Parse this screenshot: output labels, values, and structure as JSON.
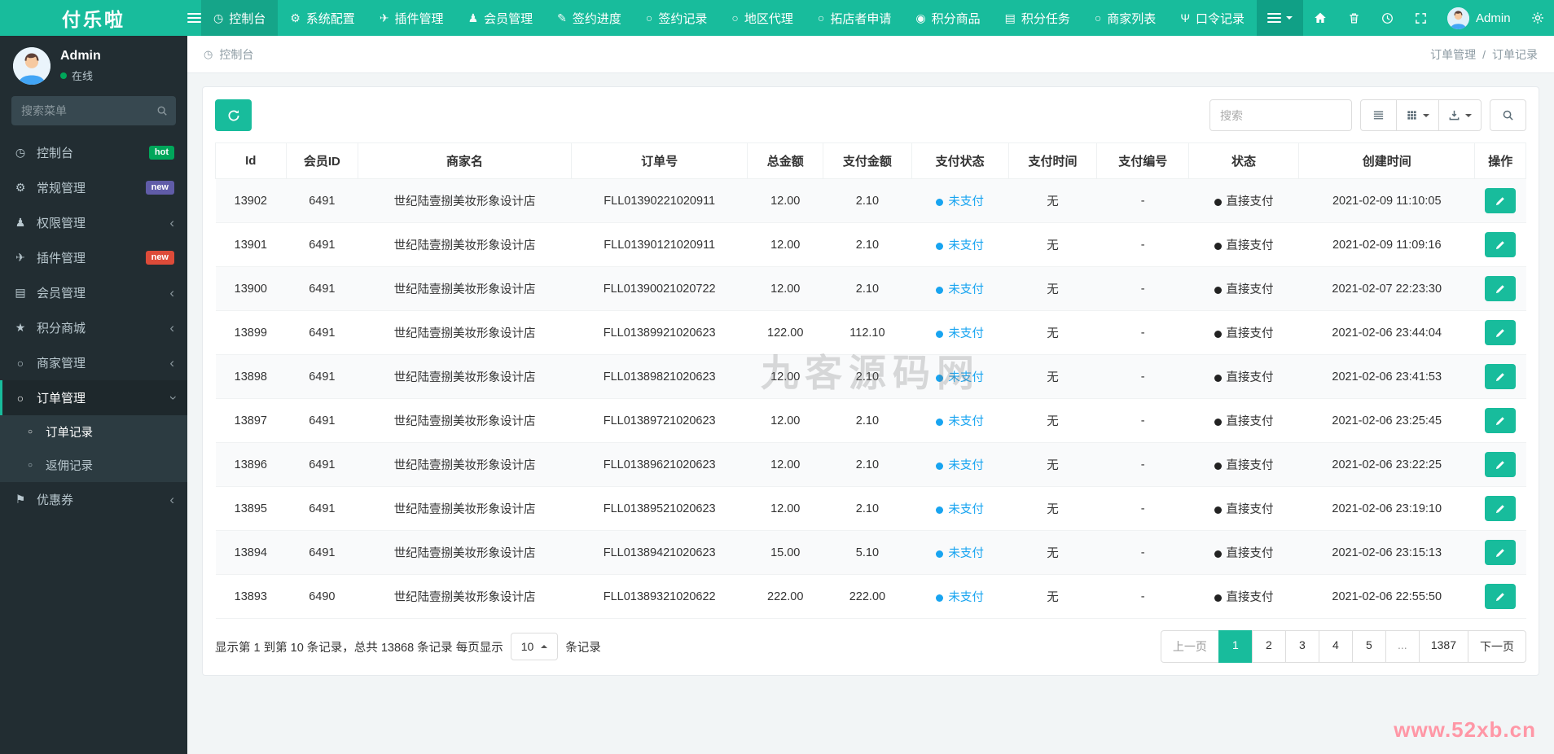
{
  "brand": "付乐啦",
  "colors": {
    "accent": "#18bc9c",
    "navbar_active": "#15a589",
    "sidebar_bg": "#222d32",
    "unpaid_blue": "#18a4f0",
    "status_dark": "#222222",
    "badge_hot": "#00a65a",
    "badge_new_purple": "#605ca8",
    "badge_new_red": "#dd4b39"
  },
  "topnav": {
    "items": [
      {
        "key": "dashboard",
        "label": "控制台",
        "glyph": "◷",
        "active": true
      },
      {
        "key": "system-config",
        "label": "系统配置",
        "glyph": "⚙"
      },
      {
        "key": "plugin-manage",
        "label": "插件管理",
        "glyph": "✈"
      },
      {
        "key": "member-manage",
        "label": "会员管理",
        "glyph": "♟"
      },
      {
        "key": "sign-progress",
        "label": "签约进度",
        "glyph": "✎"
      },
      {
        "key": "sign-records",
        "label": "签约记录",
        "glyph": "○"
      },
      {
        "key": "region-agent",
        "label": "地区代理",
        "glyph": "○"
      },
      {
        "key": "store-apply",
        "label": "拓店者申请",
        "glyph": "○"
      },
      {
        "key": "points-goods",
        "label": "积分商品",
        "glyph": "◉"
      },
      {
        "key": "points-task",
        "label": "积分任务",
        "glyph": "▤"
      },
      {
        "key": "merchant-list",
        "label": "商家列表",
        "glyph": "○"
      },
      {
        "key": "token-records",
        "label": "口令记录",
        "glyph": "Ψ"
      }
    ],
    "user_name": "Admin"
  },
  "sidebar": {
    "user": {
      "name": "Admin",
      "status": "在线"
    },
    "search_placeholder": "搜索菜单",
    "items": [
      {
        "key": "dashboard",
        "label": "控制台",
        "glyph": "◷",
        "icon": "dashboard-icon",
        "badge": {
          "text": "hot",
          "color": "#00a65a"
        }
      },
      {
        "key": "general",
        "label": "常规管理",
        "glyph": "⚙",
        "icon": "gears-icon",
        "badge": {
          "text": "new",
          "color": "#605ca8"
        }
      },
      {
        "key": "auth",
        "label": "权限管理",
        "glyph": "♟",
        "icon": "users-icon",
        "chevron": "left"
      },
      {
        "key": "addon",
        "label": "插件管理",
        "glyph": "✈",
        "icon": "plugin-icon",
        "badge": {
          "text": "new",
          "color": "#dd4b39"
        }
      },
      {
        "key": "member",
        "label": "会员管理",
        "glyph": "▤",
        "icon": "list-icon",
        "chevron": "left"
      },
      {
        "key": "points-mall",
        "label": "积分商城",
        "glyph": "★",
        "icon": "star-icon",
        "chevron": "left"
      },
      {
        "key": "merchant",
        "label": "商家管理",
        "glyph": "○",
        "icon": "circle-icon",
        "chevron": "left"
      },
      {
        "key": "order",
        "label": "订单管理",
        "glyph": "○",
        "icon": "circle-icon",
        "chevron": "down",
        "active": true,
        "children": [
          {
            "key": "order-records",
            "label": "订单记录",
            "active": true
          },
          {
            "key": "rebate-records",
            "label": "返佣记录"
          }
        ]
      },
      {
        "key": "coupon",
        "label": "优惠券",
        "glyph": "⚑",
        "icon": "bookmark-icon",
        "chevron": "left"
      }
    ]
  },
  "breadcrumb": {
    "left": "控制台",
    "parent": "订单管理",
    "separator": "/",
    "current": "订单记录"
  },
  "toolbar": {
    "search_placeholder": "搜索"
  },
  "table": {
    "headers": [
      "Id",
      "会员ID",
      "商家名",
      "订单号",
      "总金额",
      "支付金额",
      "支付状态",
      "支付时间",
      "支付编号",
      "状态",
      "创建时间",
      "操作"
    ],
    "rows": [
      {
        "id": "13902",
        "member_id": "6491",
        "merchant": "世纪陆壹捌美妆形象设计店",
        "order_no": "FLL01390221020911",
        "total": "12.00",
        "paid": "2.10",
        "pay_status": "未支付",
        "pay_time": "无",
        "pay_no": "-",
        "status": "直接支付",
        "created": "2021-02-09 11:10:05"
      },
      {
        "id": "13901",
        "member_id": "6491",
        "merchant": "世纪陆壹捌美妆形象设计店",
        "order_no": "FLL01390121020911",
        "total": "12.00",
        "paid": "2.10",
        "pay_status": "未支付",
        "pay_time": "无",
        "pay_no": "-",
        "status": "直接支付",
        "created": "2021-02-09 11:09:16"
      },
      {
        "id": "13900",
        "member_id": "6491",
        "merchant": "世纪陆壹捌美妆形象设计店",
        "order_no": "FLL01390021020722",
        "total": "12.00",
        "paid": "2.10",
        "pay_status": "未支付",
        "pay_time": "无",
        "pay_no": "-",
        "status": "直接支付",
        "created": "2021-02-07 22:23:30"
      },
      {
        "id": "13899",
        "member_id": "6491",
        "merchant": "世纪陆壹捌美妆形象设计店",
        "order_no": "FLL01389921020623",
        "total": "122.00",
        "paid": "112.10",
        "pay_status": "未支付",
        "pay_time": "无",
        "pay_no": "-",
        "status": "直接支付",
        "created": "2021-02-06 23:44:04"
      },
      {
        "id": "13898",
        "member_id": "6491",
        "merchant": "世纪陆壹捌美妆形象设计店",
        "order_no": "FLL01389821020623",
        "total": "12.00",
        "paid": "2.10",
        "pay_status": "未支付",
        "pay_time": "无",
        "pay_no": "-",
        "status": "直接支付",
        "created": "2021-02-06 23:41:53"
      },
      {
        "id": "13897",
        "member_id": "6491",
        "merchant": "世纪陆壹捌美妆形象设计店",
        "order_no": "FLL01389721020623",
        "total": "12.00",
        "paid": "2.10",
        "pay_status": "未支付",
        "pay_time": "无",
        "pay_no": "-",
        "status": "直接支付",
        "created": "2021-02-06 23:25:45"
      },
      {
        "id": "13896",
        "member_id": "6491",
        "merchant": "世纪陆壹捌美妆形象设计店",
        "order_no": "FLL01389621020623",
        "total": "12.00",
        "paid": "2.10",
        "pay_status": "未支付",
        "pay_time": "无",
        "pay_no": "-",
        "status": "直接支付",
        "created": "2021-02-06 23:22:25"
      },
      {
        "id": "13895",
        "member_id": "6491",
        "merchant": "世纪陆壹捌美妆形象设计店",
        "order_no": "FLL01389521020623",
        "total": "12.00",
        "paid": "2.10",
        "pay_status": "未支付",
        "pay_time": "无",
        "pay_no": "-",
        "status": "直接支付",
        "created": "2021-02-06 23:19:10"
      },
      {
        "id": "13894",
        "member_id": "6491",
        "merchant": "世纪陆壹捌美妆形象设计店",
        "order_no": "FLL01389421020623",
        "total": "15.00",
        "paid": "5.10",
        "pay_status": "未支付",
        "pay_time": "无",
        "pay_no": "-",
        "status": "直接支付",
        "created": "2021-02-06 23:15:13"
      },
      {
        "id": "13893",
        "member_id": "6490",
        "merchant": "世纪陆壹捌美妆形象设计店",
        "order_no": "FLL01389321020622",
        "total": "222.00",
        "paid": "222.00",
        "pay_status": "未支付",
        "pay_time": "无",
        "pay_no": "-",
        "status": "直接支付",
        "created": "2021-02-06 22:55:50"
      }
    ]
  },
  "footer": {
    "summary_prefix": "显示第 1 到第 10 条记录，总共 13868 条记录 每页显示",
    "page_size": "10",
    "summary_suffix": "条记录",
    "pages": [
      {
        "label": "上一页",
        "type": "prev",
        "disabled": true
      },
      {
        "label": "1",
        "active": true
      },
      {
        "label": "2"
      },
      {
        "label": "3"
      },
      {
        "label": "4"
      },
      {
        "label": "5"
      },
      {
        "label": "...",
        "type": "ellipsis",
        "disabled": true
      },
      {
        "label": "1387"
      },
      {
        "label": "下一页",
        "type": "next"
      }
    ]
  },
  "watermark": {
    "center": "九客源码网",
    "corner": "www.52xb.cn"
  }
}
